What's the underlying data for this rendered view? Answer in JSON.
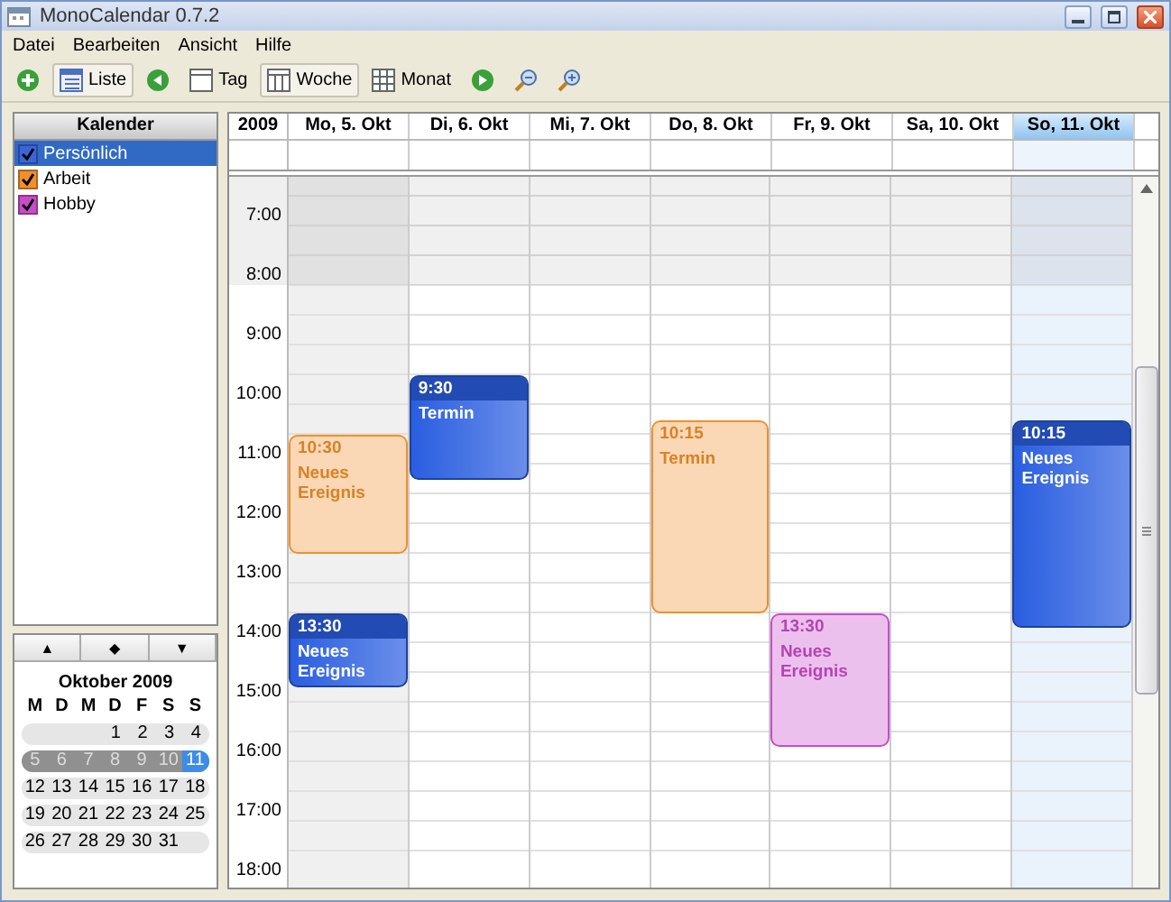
{
  "window": {
    "title": "MonoCalendar 0.7.2"
  },
  "menu": [
    "Datei",
    "Bearbeiten",
    "Ansicht",
    "Hilfe"
  ],
  "toolbar": [
    {
      "kind": "add",
      "pressed": false
    },
    {
      "kind": "list",
      "label": "Liste",
      "pressed": true
    },
    {
      "kind": "prev",
      "pressed": false
    },
    {
      "kind": "day",
      "label": "Tag",
      "pressed": false
    },
    {
      "kind": "week",
      "label": "Woche",
      "pressed": true
    },
    {
      "kind": "month",
      "label": "Monat",
      "pressed": false
    },
    {
      "kind": "next",
      "pressed": false
    },
    {
      "kind": "zoom-out",
      "pressed": false
    },
    {
      "kind": "zoom-in",
      "pressed": false
    }
  ],
  "calendars": {
    "title": "Kalender",
    "items": [
      {
        "label": "Persönlich",
        "checked": true,
        "selected": true,
        "color": "#3a64d8"
      },
      {
        "label": "Arbeit",
        "checked": true,
        "selected": false,
        "color": "#f0902c"
      },
      {
        "label": "Hobby",
        "checked": true,
        "selected": false,
        "color": "#c84cc8"
      }
    ]
  },
  "mini_calendar": {
    "nav": [
      "▲",
      "◆",
      "▼"
    ],
    "title": "Oktober 2009",
    "weekdays": [
      "M",
      "D",
      "M",
      "D",
      "F",
      "S",
      "S"
    ],
    "weeks": [
      {
        "selected": false,
        "days": [
          {
            "label": "1",
            "selected": false
          },
          {
            "label": "2",
            "selected": false
          },
          {
            "label": "3",
            "selected": false
          },
          {
            "label": "4",
            "selected": false
          }
        ]
      },
      {
        "selected": true,
        "days": [
          {
            "label": "5",
            "selected": false
          },
          {
            "label": "6",
            "selected": false
          },
          {
            "label": "7",
            "selected": false
          },
          {
            "label": "8",
            "selected": false
          },
          {
            "label": "9",
            "selected": false
          },
          {
            "label": "10",
            "selected": false
          },
          {
            "label": "11",
            "selected": true
          }
        ]
      },
      {
        "selected": false,
        "days": [
          {
            "label": "12",
            "selected": false
          },
          {
            "label": "13",
            "selected": false
          },
          {
            "label": "14",
            "selected": false
          },
          {
            "label": "15",
            "selected": false
          },
          {
            "label": "16",
            "selected": false
          },
          {
            "label": "17",
            "selected": false
          },
          {
            "label": "18",
            "selected": false
          }
        ]
      },
      {
        "selected": false,
        "days": [
          {
            "label": "19",
            "selected": false
          },
          {
            "label": "20",
            "selected": false
          },
          {
            "label": "21",
            "selected": false
          },
          {
            "label": "22",
            "selected": false
          },
          {
            "label": "23",
            "selected": false
          },
          {
            "label": "24",
            "selected": false
          },
          {
            "label": "25",
            "selected": false
          }
        ]
      },
      {
        "selected": false,
        "days": [
          {
            "label": "26",
            "selected": false
          },
          {
            "label": "27",
            "selected": false
          },
          {
            "label": "28",
            "selected": false
          },
          {
            "label": "29",
            "selected": false
          },
          {
            "label": "30",
            "selected": false
          },
          {
            "label": "31",
            "selected": false
          }
        ]
      }
    ]
  },
  "week_view": {
    "year": "2009",
    "hours": [
      "7:00",
      "8:00",
      "9:00",
      "10:00",
      "11:00",
      "12:00",
      "13:00",
      "14:00",
      "15:00",
      "16:00",
      "17:00",
      "18:00"
    ],
    "days": [
      {
        "label": "Mo, 5. Okt",
        "selected": false,
        "shaded": true,
        "events": [
          {
            "start": "10:30",
            "title": "Neues Ereignis",
            "color": "#f0902c",
            "highlighted": false
          },
          {
            "start": "13:30",
            "title": "Neues Ereignis",
            "color": "#2a5ee0",
            "highlighted": true
          }
        ]
      },
      {
        "label": "Di, 6. Okt",
        "selected": false,
        "shaded": false,
        "events": [
          {
            "start": "9:30",
            "title": "Termin",
            "color": "#2a5ee0",
            "highlighted": true
          }
        ]
      },
      {
        "label": "Mi, 7. Okt",
        "selected": false,
        "shaded": false
      },
      {
        "label": "Do, 8. Okt",
        "selected": false,
        "shaded": false,
        "events": [
          {
            "start": "10:15",
            "title": "Termin",
            "color": "#f0902c",
            "highlighted": false
          }
        ]
      },
      {
        "label": "Fr, 9. Okt",
        "selected": false,
        "shaded": false,
        "events": [
          {
            "start": "13:30",
            "title": "Neues Ereignis",
            "color": "#c84cc8",
            "highlighted": false
          }
        ]
      },
      {
        "label": "Sa, 10. Okt",
        "selected": false,
        "shaded": false
      },
      {
        "label": "So, 11. Okt",
        "selected": true,
        "shaded": false,
        "events": [
          {
            "start": "10:15",
            "title": "Neues Ereignis",
            "color": "#2a5ee0",
            "highlighted": true
          }
        ]
      }
    ]
  }
}
